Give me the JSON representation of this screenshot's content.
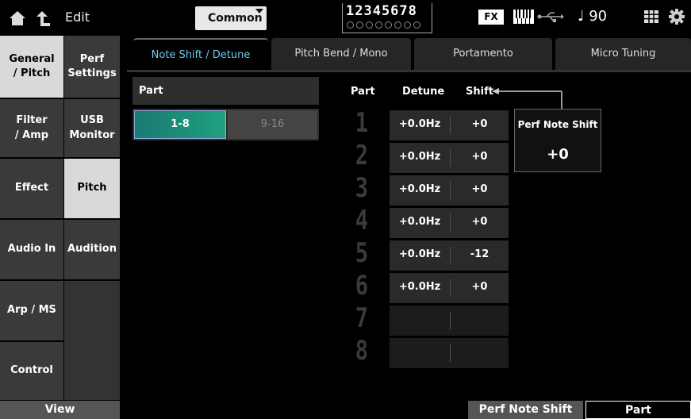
{
  "header": {
    "edit_label": "Edit",
    "common_label": "Common",
    "parts_digits": "12345678",
    "fx_label": "FX",
    "tempo": "♩ 90",
    "icons": [
      "home-icon",
      "up-icon",
      "keyboard-icon",
      "usb-icon",
      "grid-icon",
      "gear-icon"
    ]
  },
  "nav": {
    "col1": [
      {
        "label": "General\n/ Pitch",
        "active": true
      },
      {
        "label": "Filter\n/ Amp"
      },
      {
        "label": "Effect"
      },
      {
        "label": "Audio In"
      },
      {
        "label": "Arp / MS"
      },
      {
        "label": "Control"
      }
    ],
    "col2": [
      {
        "label": "Perf\nSettings"
      },
      {
        "label": "USB\nMonitor"
      },
      {
        "label": "Pitch",
        "active": true
      },
      {
        "label": "Audition"
      }
    ],
    "view_label": "View"
  },
  "tabs": [
    {
      "label": "Note Shift / Detune",
      "active": true
    },
    {
      "label": "Pitch Bend / Mono"
    },
    {
      "label": "Portamento"
    },
    {
      "label": "Micro Tuning"
    }
  ],
  "part_select": {
    "header": "Part",
    "options": [
      "1-8",
      "9-16"
    ],
    "selected": "1-8"
  },
  "table": {
    "headers": {
      "part": "Part",
      "detune": "Detune",
      "shift": "Shift"
    },
    "rows": [
      {
        "part": "1",
        "detune": "+0.0Hz",
        "shift": "+0"
      },
      {
        "part": "2",
        "detune": "+0.0Hz",
        "shift": "+0"
      },
      {
        "part": "3",
        "detune": "+0.0Hz",
        "shift": "+0"
      },
      {
        "part": "4",
        "detune": "+0.0Hz",
        "shift": "+0"
      },
      {
        "part": "5",
        "detune": "+0.0Hz",
        "shift": "-12"
      },
      {
        "part": "6",
        "detune": "+0.0Hz",
        "shift": "+0"
      },
      {
        "part": "7",
        "detune": "",
        "shift": ""
      },
      {
        "part": "8",
        "detune": "",
        "shift": ""
      }
    ]
  },
  "perf_note_shift": {
    "title": "Perf Note Shift",
    "value": "+0"
  },
  "bottom": {
    "perf_note_shift_label": "Perf Note Shift",
    "part_label": "Part"
  },
  "colors": {
    "accent": "#6ec8ee",
    "selected_part": "#1a7a72"
  }
}
